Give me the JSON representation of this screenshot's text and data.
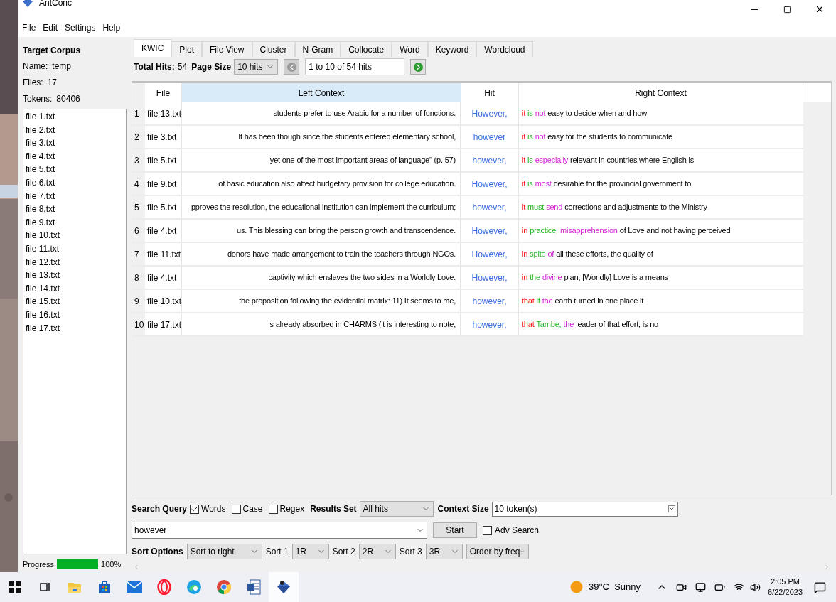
{
  "window": {
    "title": "AntConc"
  },
  "menu": [
    "File",
    "Edit",
    "Settings",
    "Help"
  ],
  "corpus": {
    "heading": "Target Corpus",
    "fields": [
      {
        "label": "Name:",
        "value": "temp"
      },
      {
        "label": "Files:",
        "value": "17"
      },
      {
        "label": "Tokens:",
        "value": "80406"
      }
    ],
    "files": [
      "file 1.txt",
      "file 2.txt",
      "file 3.txt",
      "file 4.txt",
      "file 5.txt",
      "file 6.txt",
      "file 7.txt",
      "file 8.txt",
      "file 9.txt",
      "file 10.txt",
      "file 11.txt",
      "file 12.txt",
      "file 13.txt",
      "file 14.txt",
      "file 15.txt",
      "file 16.txt",
      "file 17.txt"
    ],
    "progress": {
      "label": "Progress",
      "level": 1,
      "reading": "100%"
    }
  },
  "tabs": [
    {
      "label": "KWIC",
      "selected": true
    },
    {
      "label": "Plot",
      "selected": false
    },
    {
      "label": "File View",
      "selected": false
    },
    {
      "label": "Cluster",
      "selected": false
    },
    {
      "label": "N-Gram",
      "selected": false
    },
    {
      "label": "Collocate",
      "selected": false
    },
    {
      "label": "Word",
      "selected": false
    },
    {
      "label": "Keyword",
      "selected": false
    },
    {
      "label": "Wordcloud",
      "selected": false
    }
  ],
  "toolbar": {
    "total_label": "Total Hits:",
    "total": "54",
    "page_size_label": "Page Size",
    "page_size": "10 hits",
    "page_range": "1 to 10 of 54 hits"
  },
  "table": {
    "columns": [
      "File",
      "Left Context",
      "Hit",
      "Right Context"
    ],
    "rows": [
      {
        "n": "1",
        "file": "file 13.txt",
        "left": "students prefer to use Arabic for a number of functions.",
        "hit": "However,",
        "right": [
          {
            "text": "it",
            "kind": "first"
          },
          {
            "text": "is",
            "kind": "second"
          },
          {
            "text": "not",
            "kind": "third"
          },
          {
            "text": "easy to decide when and how",
            "kind": "plain"
          }
        ]
      },
      {
        "n": "2",
        "file": "file 3.txt",
        "left": "It has been though since the students entered elementary school,",
        "hit": "however",
        "right": [
          {
            "text": "it",
            "kind": "first"
          },
          {
            "text": "is",
            "kind": "second"
          },
          {
            "text": "not",
            "kind": "third"
          },
          {
            "text": "easy for the students to communicate",
            "kind": "plain"
          }
        ]
      },
      {
        "n": "3",
        "file": "file 5.txt",
        "left": "yet one of the most important areas of language\" (p. 57)",
        "hit": "however,",
        "right": [
          {
            "text": "it",
            "kind": "first"
          },
          {
            "text": "is",
            "kind": "second"
          },
          {
            "text": "especially",
            "kind": "third"
          },
          {
            "text": "relevant in countries where English is",
            "kind": "plain"
          }
        ]
      },
      {
        "n": "4",
        "file": "file 9.txt",
        "left": "of basic education also affect budgetary provision for college education.",
        "hit": "However,",
        "right": [
          {
            "text": "it",
            "kind": "first"
          },
          {
            "text": "is",
            "kind": "second"
          },
          {
            "text": "most",
            "kind": "third"
          },
          {
            "text": "desirable for the provincial government to",
            "kind": "plain"
          }
        ]
      },
      {
        "n": "5",
        "file": "file 5.txt",
        "left": "pproves the resolution, the educational institution can implement the curriculum;",
        "hit": "however,",
        "right": [
          {
            "text": "it",
            "kind": "first"
          },
          {
            "text": "must",
            "kind": "second"
          },
          {
            "text": "send",
            "kind": "third"
          },
          {
            "text": "corrections and adjustments to the Ministry",
            "kind": "plain"
          }
        ]
      },
      {
        "n": "6",
        "file": "file 4.txt",
        "left": "us. This blessing can bring the person growth and transcendence.",
        "hit": "However,",
        "right": [
          {
            "text": "in",
            "kind": "first"
          },
          {
            "text": "practice,",
            "kind": "second"
          },
          {
            "text": "misapprehension",
            "kind": "third"
          },
          {
            "text": "of Love and not having perceived",
            "kind": "plain"
          }
        ]
      },
      {
        "n": "7",
        "file": "file 11.txt",
        "left": "donors have made arrangement to train the teachers through NGOs.",
        "hit": "However,",
        "right": [
          {
            "text": "in",
            "kind": "first"
          },
          {
            "text": "spite",
            "kind": "second"
          },
          {
            "text": "of",
            "kind": "third"
          },
          {
            "text": "all these efforts, the quality of",
            "kind": "plain"
          }
        ]
      },
      {
        "n": "8",
        "file": "file 4.txt",
        "left": "captivity which enslaves the two sides in a Worldly Love.",
        "hit": "However,",
        "right": [
          {
            "text": "in",
            "kind": "first"
          },
          {
            "text": "the",
            "kind": "second"
          },
          {
            "text": "divine",
            "kind": "third"
          },
          {
            "text": "plan, [Worldly] Love is a means",
            "kind": "plain"
          }
        ]
      },
      {
        "n": "9",
        "file": "file 10.txt",
        "left": "the proposition following the evidential matrix: 11) It seems to me,",
        "hit": "however,",
        "right": [
          {
            "text": "that",
            "kind": "first"
          },
          {
            "text": "if",
            "kind": "second"
          },
          {
            "text": "the",
            "kind": "third"
          },
          {
            "text": "earth turned in one place it",
            "kind": "plain"
          }
        ]
      },
      {
        "n": "10",
        "file": "file 17.txt",
        "left": "is already absorbed in CHARMS (it is interesting to note,",
        "hit": "however,",
        "right": [
          {
            "text": "that",
            "kind": "first"
          },
          {
            "text": "Tambe,",
            "kind": "second"
          },
          {
            "text": "the",
            "kind": "third"
          },
          {
            "text": "leader of that effort, is no",
            "kind": "plain"
          }
        ]
      }
    ]
  },
  "search": {
    "label": "Search Query",
    "options": [
      {
        "label": "Words",
        "checked": true
      },
      {
        "label": "Case",
        "checked": false
      },
      {
        "label": "Regex",
        "checked": false
      }
    ],
    "results_label": "Results Set",
    "results": "All hits",
    "context_label": "Context Size",
    "context": "10 token(s)",
    "query": "however",
    "start": "Start",
    "adv": {
      "label": "Adv Search",
      "checked": false
    }
  },
  "sort": {
    "label": "Sort Options",
    "mode": "Sort to right",
    "levels": [
      {
        "label": "Sort 1",
        "value": "1R"
      },
      {
        "label": "Sort 2",
        "value": "2R"
      },
      {
        "label": "Sort 3",
        "value": "3R"
      }
    ],
    "order": "Order by freq"
  },
  "taskbar": {
    "apps": [
      {
        "kind": "start",
        "selected": false
      },
      {
        "kind": "taskview",
        "selected": false
      },
      {
        "kind": "folder",
        "selected": false
      },
      {
        "kind": "store",
        "selected": false
      },
      {
        "kind": "mail",
        "selected": false
      },
      {
        "kind": "ring",
        "selected": false
      },
      {
        "kind": "wave",
        "selected": false
      },
      {
        "kind": "chrome",
        "selected": false
      },
      {
        "kind": "doc",
        "selected": false
      },
      {
        "kind": "antconc",
        "selected": true
      }
    ],
    "weather": "39°C  Sunny",
    "time": "2:05 PM",
    "date": "6/22/2023"
  }
}
